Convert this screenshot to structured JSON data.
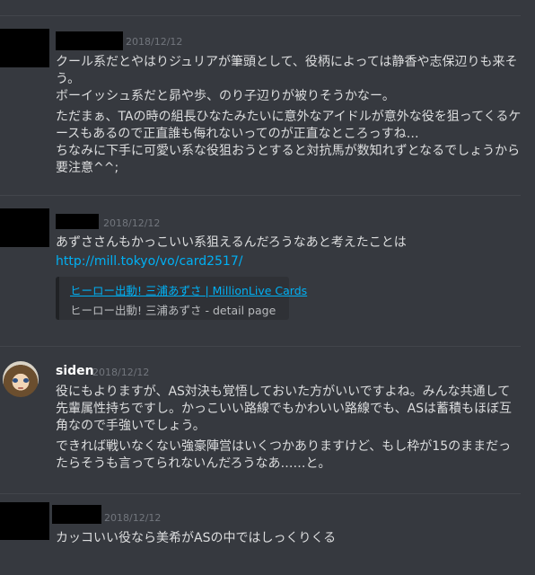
{
  "messages": [
    {
      "timestamp": "2018/12/12",
      "paragraphs": [
        "クール系だとやはりジュリアが筆頭として、役柄によっては静香や志保辺りも来そう。\nボーイッシュ系だと昴や歩、のり子辺りが被りそうかなー。",
        "ただまぁ、TAの時の組長ひなたみたいに意外なアイドルが意外な役を狙ってくるケースもあるので正直誰も侮れないってのが正直なところっすね…\nちなみに下手に可愛い系な役狙おうとすると対抗馬が数知れずとなるでしょうから要注意^^;"
      ]
    },
    {
      "timestamp": "2018/12/12",
      "text": "あずささんもかっこいい系狙えるんだろうなあと考えたことは",
      "link": "http://mill.tokyo/vo/card2517/",
      "embed": {
        "title": "ヒーロー出動! 三浦あずさ | MillionLive Cards",
        "description": "ヒーロー出動! 三浦あずさ - detail page"
      }
    },
    {
      "username": "siden",
      "timestamp": "2018/12/12",
      "paragraphs": [
        "役にもよりますが、AS対決も覚悟しておいた方がいいですよね。みんな共通して先輩属性持ちですし。かっこいい路線でもかわいい路線でも、ASは蓄積もほぼ互角なので手強いでしょう。",
        "できれば戦いなくない強豪陣営はいくつかありますけど、もし枠が15のままだったらそうも言ってられないんだろうなあ……と。"
      ]
    },
    {
      "timestamp": "2018/12/12",
      "text": "カッコいい役なら美希がASの中ではしっくりくる"
    }
  ]
}
